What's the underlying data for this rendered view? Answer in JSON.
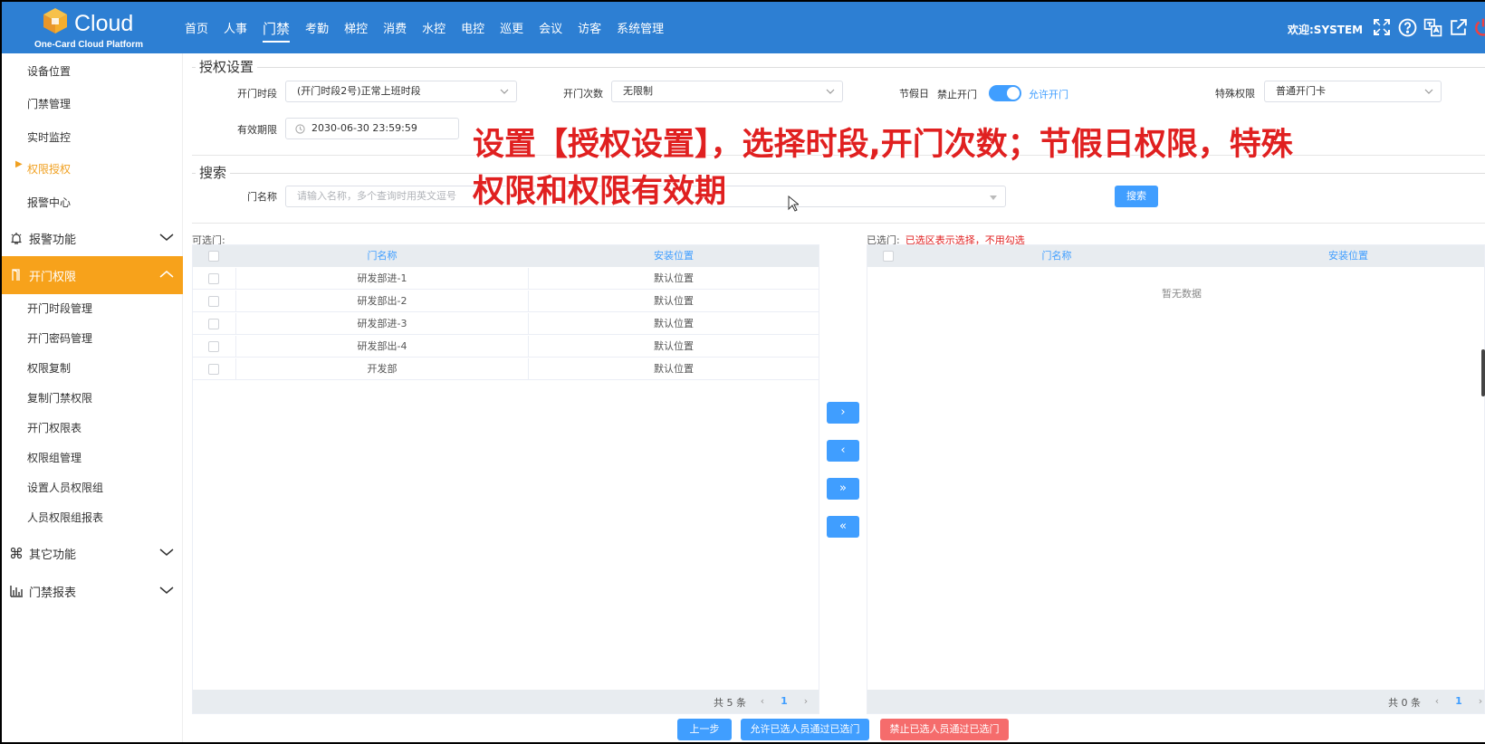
{
  "header": {
    "logo_word": "Cloud",
    "logo_sub": "One-Card Cloud Platform",
    "nav": [
      "首页",
      "人事",
      "门禁",
      "考勤",
      "梯控",
      "消费",
      "水控",
      "电控",
      "巡更",
      "会议",
      "访客",
      "系统管理"
    ],
    "welcome": "欢迎:SYSTEM",
    "icons": [
      "fullscreen-icon",
      "help-icon",
      "translate-icon",
      "external-link-icon",
      "power-icon"
    ]
  },
  "sidebar": {
    "top_items": [
      "设备位置",
      "门禁管理",
      "实时监控",
      "权限授权",
      "报警中心"
    ],
    "group_alarm": "报警功能",
    "group_door": "开门权限",
    "door_items": [
      "开门时段管理",
      "开门密码管理",
      "权限复制",
      "复制门禁权限",
      "开门权限表",
      "权限组管理",
      "设置人员权限组",
      "人员权限组报表"
    ],
    "group_other": "其它功能",
    "group_report": "门禁报表"
  },
  "auth": {
    "title": "授权设置",
    "period_label": "开门时段",
    "period_value": "(开门时段2号)正常上班时段",
    "count_label": "开门次数",
    "count_value": "无限制",
    "holiday_label": "节假日",
    "holiday_off": "禁止开门",
    "holiday_on": "允许开门",
    "special_label": "特殊权限",
    "special_value": "普通开门卡",
    "expiry_label": "有效期限",
    "expiry_value": "2030-06-30 23:59:59"
  },
  "search": {
    "title": "搜索",
    "door_label": "门名称",
    "placeholder": "请输入名称，多个查询时用英文逗号",
    "button": "搜索"
  },
  "available": {
    "label": "可选门:",
    "col_name": "门名称",
    "col_location": "安装位置",
    "rows": [
      {
        "name": "研发部进-1",
        "location": "默认位置"
      },
      {
        "name": "研发部出-2",
        "location": "默认位置"
      },
      {
        "name": "研发部进-3",
        "location": "默认位置"
      },
      {
        "name": "研发部出-4",
        "location": "默认位置"
      },
      {
        "name": "开发部",
        "location": "默认位置"
      }
    ],
    "total": "共 5 条",
    "page": "1"
  },
  "selected": {
    "label": "已选门:",
    "note": "已选区表示选择，不用勾选",
    "col_name": "门名称",
    "col_location": "安装位置",
    "empty": "暂无数据",
    "total": "共 0 条",
    "page": "1"
  },
  "transfer": {
    "right": "›",
    "left": "‹",
    "all_right": "»",
    "all_left": "«"
  },
  "actions": {
    "prev": "上一步",
    "allow": "允许已选人员通过已选门",
    "deny": "禁止已选人员通过已选门"
  },
  "overlay_caption": [
    "设置【授权设置】，选择时段,开门次数；节假日权限，特殊",
    "权限和权限有效期"
  ],
  "colors": {
    "header": "#2d7fd3",
    "accent": "#f7a21b",
    "primary": "#409eff",
    "danger": "#f56c6c"
  }
}
